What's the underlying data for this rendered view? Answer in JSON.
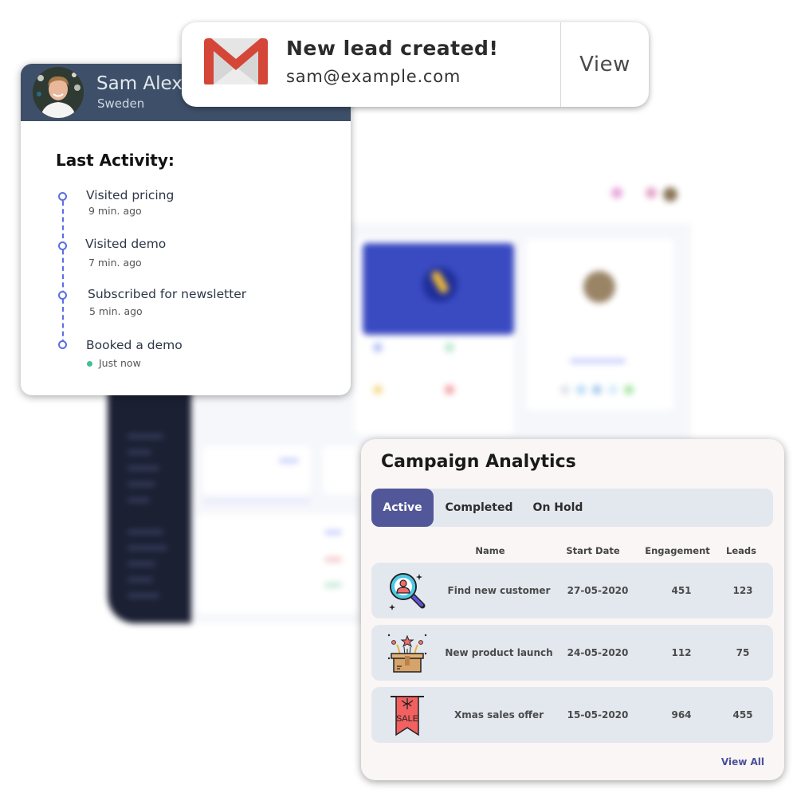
{
  "notification": {
    "icon": "gmail-icon",
    "title": "New lead created!",
    "email": "sam@example.com",
    "action_label": "View",
    "brand_color": "#D44638"
  },
  "activity_card": {
    "header_color": "#3E5069",
    "profile": {
      "name": "Sam Alex",
      "country": "Sweden"
    },
    "heading": "Last Activity:",
    "timeline_color": "#5B6EE0",
    "items": [
      {
        "title": "Visited pricing",
        "time": "9  min. ago"
      },
      {
        "title": "Visited demo",
        "time": "7 min. ago"
      },
      {
        "title": "Subscribed for newsletter",
        "time": "5 min. ago"
      },
      {
        "title": "Booked a demo",
        "time": "Just now",
        "live": true
      }
    ],
    "live_color": "#3EC28F"
  },
  "campaign": {
    "title": "Campaign Analytics",
    "accent_color": "#52579A",
    "tabs": [
      {
        "label": "Active",
        "active": true
      },
      {
        "label": "Completed",
        "active": false
      },
      {
        "label": "On Hold",
        "active": false
      }
    ],
    "columns": [
      "Name",
      "Start Date",
      "Engagement",
      "Leads"
    ],
    "rows": [
      {
        "icon": "search-customer-icon",
        "name": "Find new customer",
        "start_date": "27-05-2020",
        "engagement": "451",
        "leads": "123"
      },
      {
        "icon": "product-launch-box-icon",
        "name": "New product launch",
        "start_date": "24-05-2020",
        "engagement": "112",
        "leads": "75"
      },
      {
        "icon": "sale-banner-icon",
        "name": "Xmas sales offer",
        "start_date": "15-05-2020",
        "engagement": "964",
        "leads": "455"
      }
    ],
    "sale_icon_text": "SALE",
    "view_all_label": "View All"
  }
}
